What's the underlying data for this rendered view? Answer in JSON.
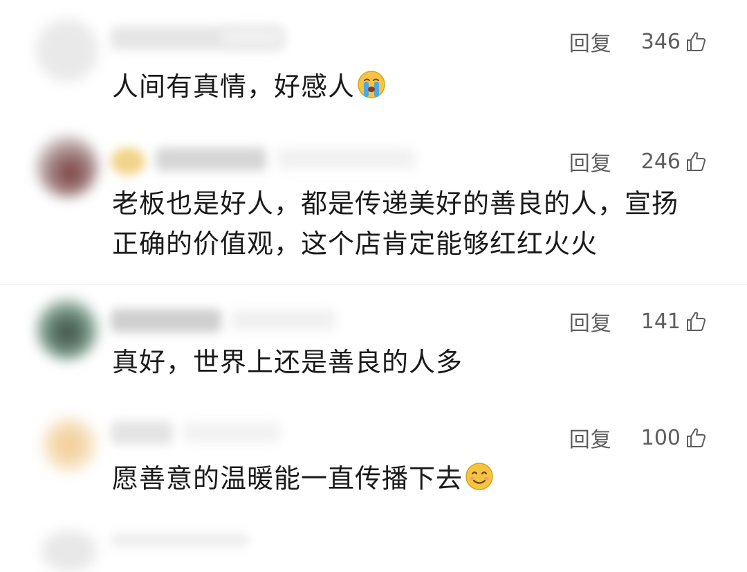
{
  "colors": {
    "text": "#1a1a1a",
    "meta": "#5e5e5e",
    "background": "#ffffff"
  },
  "comments": [
    {
      "reply_label": "回复",
      "like_count": "346",
      "like_icon": "thumbs-up-outline-icon",
      "text": "人间有真情，好感人",
      "emoji": "loudly-crying-face-emoji"
    },
    {
      "reply_label": "回复",
      "like_count": "246",
      "like_icon": "thumbs-up-outline-icon",
      "text_line1": "老板也是好人，都是传递美好的善良的人，宣扬",
      "text_line2": "正确的价值观，这个店肯定能够红红火火"
    },
    {
      "reply_label": "回复",
      "like_count": "141",
      "like_icon": "thumbs-up-outline-icon",
      "text": "真好，世界上还是善良的人多"
    },
    {
      "reply_label": "回复",
      "like_count": "100",
      "like_icon": "thumbs-up-outline-icon",
      "text": "愿善意的温暖能一直传播下去",
      "emoji": "smiling-face-emoji"
    }
  ]
}
